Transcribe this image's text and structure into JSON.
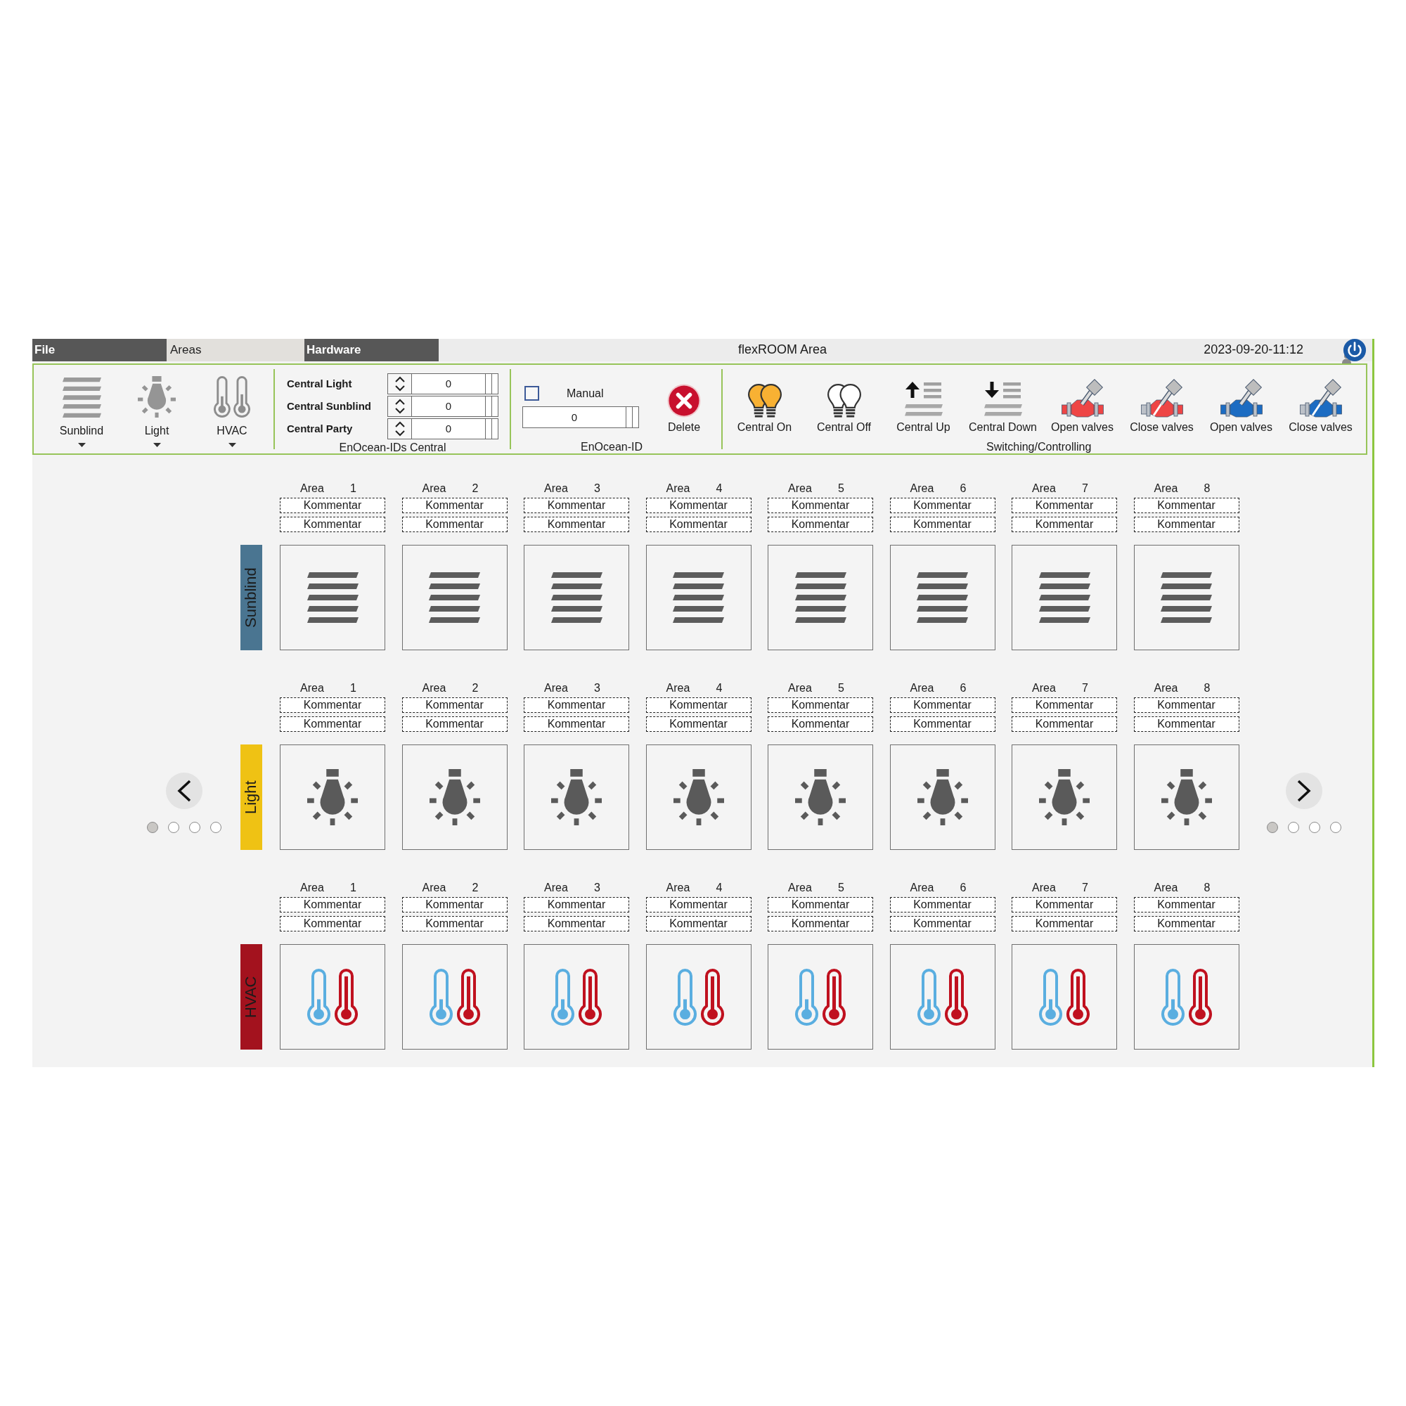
{
  "menu": {
    "tabs": [
      {
        "label": "File",
        "selected": false
      },
      {
        "label": "Areas",
        "selected": true
      },
      {
        "label": "Hardware",
        "selected": false
      }
    ],
    "title": "flexROOM Area",
    "datetime": "2023-09-20-11:12"
  },
  "toolbar": {
    "categories": [
      {
        "label": "Sunblind",
        "kind": "sunblind"
      },
      {
        "label": "Light",
        "kind": "light"
      },
      {
        "label": "HVAC",
        "kind": "hvac"
      }
    ],
    "central_ids": {
      "rows": [
        {
          "label": "Central Light",
          "value": "0"
        },
        {
          "label": "Central Sunblind",
          "value": "0"
        },
        {
          "label": "Central Party",
          "value": "0"
        }
      ],
      "caption": "EnOcean-IDs Central"
    },
    "enocean_id": {
      "manual": {
        "label": "Manual",
        "checked": false
      },
      "value": "0",
      "delete_label": "Delete",
      "caption": "EnOcean-ID"
    },
    "switching": {
      "buttons": [
        {
          "label": "Central On",
          "kind": "lamps_on"
        },
        {
          "label": "Central Off",
          "kind": "lamps_off"
        },
        {
          "label": "Central Up",
          "kind": "blinds_up"
        },
        {
          "label": "Central Down",
          "kind": "blinds_down"
        },
        {
          "label": "Open valves",
          "kind": "valve_open",
          "color": "#ee4545"
        },
        {
          "label": "Close valves",
          "kind": "valve_close",
          "color": "#ee4545"
        },
        {
          "label": "Open valves",
          "kind": "valve_open",
          "color": "#1c6cc2"
        },
        {
          "label": "Close valves",
          "kind": "valve_close",
          "color": "#1c6cc2"
        }
      ],
      "caption": "Switching/Controlling"
    }
  },
  "pager_left": {
    "pages": [
      {
        "selected": true
      },
      {
        "selected": false
      },
      {
        "selected": false
      },
      {
        "selected": false
      }
    ]
  },
  "pager_right": {
    "pages": [
      {
        "selected": true
      },
      {
        "selected": false
      },
      {
        "selected": false
      },
      {
        "selected": false
      }
    ]
  },
  "rows": [
    {
      "label": "Sunblind",
      "kind": "sunblind",
      "color": "#4a7591",
      "areas": [
        {
          "label": "Area",
          "number": "1",
          "comments": [
            "Kommentar",
            "Kommentar"
          ]
        },
        {
          "label": "Area",
          "number": "2",
          "comments": [
            "Kommentar",
            "Kommentar"
          ]
        },
        {
          "label": "Area",
          "number": "3",
          "comments": [
            "Kommentar",
            "Kommentar"
          ]
        },
        {
          "label": "Area",
          "number": "4",
          "comments": [
            "Kommentar",
            "Kommentar"
          ]
        },
        {
          "label": "Area",
          "number": "5",
          "comments": [
            "Kommentar",
            "Kommentar"
          ]
        },
        {
          "label": "Area",
          "number": "6",
          "comments": [
            "Kommentar",
            "Kommentar"
          ]
        },
        {
          "label": "Area",
          "number": "7",
          "comments": [
            "Kommentar",
            "Kommentar"
          ]
        },
        {
          "label": "Area",
          "number": "8",
          "comments": [
            "Kommentar",
            "Kommentar"
          ]
        }
      ]
    },
    {
      "label": "Light",
      "kind": "light",
      "color": "#efc214",
      "areas": [
        {
          "label": "Area",
          "number": "1",
          "comments": [
            "Kommentar",
            "Kommentar"
          ]
        },
        {
          "label": "Area",
          "number": "2",
          "comments": [
            "Kommentar",
            "Kommentar"
          ]
        },
        {
          "label": "Area",
          "number": "3",
          "comments": [
            "Kommentar",
            "Kommentar"
          ]
        },
        {
          "label": "Area",
          "number": "4",
          "comments": [
            "Kommentar",
            "Kommentar"
          ]
        },
        {
          "label": "Area",
          "number": "5",
          "comments": [
            "Kommentar",
            "Kommentar"
          ]
        },
        {
          "label": "Area",
          "number": "6",
          "comments": [
            "Kommentar",
            "Kommentar"
          ]
        },
        {
          "label": "Area",
          "number": "7",
          "comments": [
            "Kommentar",
            "Kommentar"
          ]
        },
        {
          "label": "Area",
          "number": "8",
          "comments": [
            "Kommentar",
            "Kommentar"
          ]
        }
      ]
    },
    {
      "label": "HVAC",
      "kind": "hvac",
      "color": "#a3121e",
      "areas": [
        {
          "label": "Area",
          "number": "1",
          "comments": [
            "Kommentar",
            "Kommentar"
          ]
        },
        {
          "label": "Area",
          "number": "2",
          "comments": [
            "Kommentar",
            "Kommentar"
          ]
        },
        {
          "label": "Area",
          "number": "3",
          "comments": [
            "Kommentar",
            "Kommentar"
          ]
        },
        {
          "label": "Area",
          "number": "4",
          "comments": [
            "Kommentar",
            "Kommentar"
          ]
        },
        {
          "label": "Area",
          "number": "5",
          "comments": [
            "Kommentar",
            "Kommentar"
          ]
        },
        {
          "label": "Area",
          "number": "6",
          "comments": [
            "Kommentar",
            "Kommentar"
          ]
        },
        {
          "label": "Area",
          "number": "7",
          "comments": [
            "Kommentar",
            "Kommentar"
          ]
        },
        {
          "label": "Area",
          "number": "8",
          "comments": [
            "Kommentar",
            "Kommentar"
          ]
        }
      ]
    }
  ]
}
